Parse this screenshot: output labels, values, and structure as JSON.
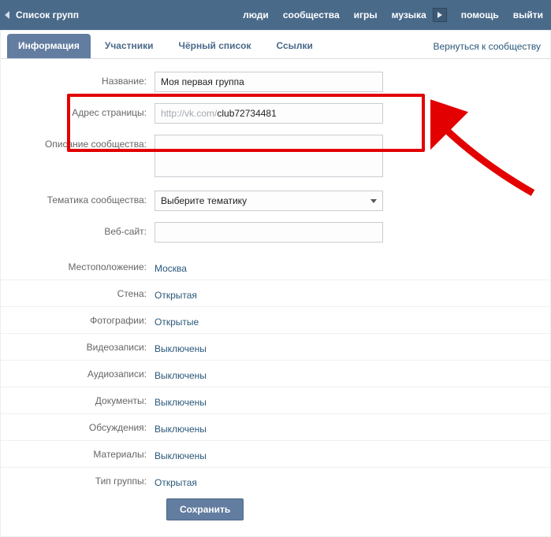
{
  "topbar": {
    "title": "Список групп",
    "nav": {
      "people": "люди",
      "communities": "сообщества",
      "games": "игры",
      "music": "музыка",
      "help": "помощь",
      "logout": "выйти"
    }
  },
  "tabs": {
    "info": "Информация",
    "members": "Участники",
    "blacklist": "Чёрный список",
    "links": "Ссылки",
    "back": "Вернуться к сообществу"
  },
  "form": {
    "name_label": "Название:",
    "name_value": "Моя первая группа",
    "url_label": "Адрес страницы:",
    "url_prefix": "http://vk.com/",
    "url_value": "club72734481",
    "desc_label": "Описание сообщества:",
    "desc_value": "",
    "topic_label": "Тематика сообщества:",
    "topic_placeholder": "Выберите тематику",
    "website_label": "Веб-сайт:",
    "website_value": ""
  },
  "options": {
    "location_label": "Местоположение:",
    "location_value": "Москва",
    "wall_label": "Стена:",
    "wall_value": "Открытая",
    "photos_label": "Фотографии:",
    "photos_value": "Открытые",
    "videos_label": "Видеозаписи:",
    "videos_value": "Выключены",
    "audio_label": "Аудиозаписи:",
    "audio_value": "Выключены",
    "docs_label": "Документы:",
    "docs_value": "Выключены",
    "discussions_label": "Обсуждения:",
    "discussions_value": "Выключены",
    "materials_label": "Материалы:",
    "materials_value": "Выключены",
    "type_label": "Тип группы:",
    "type_value": "Открытая"
  },
  "save_label": "Сохранить",
  "colors": {
    "header": "#4a6a8a",
    "tab_active": "#627da0",
    "link": "#2b587a",
    "highlight": "#e30000"
  }
}
